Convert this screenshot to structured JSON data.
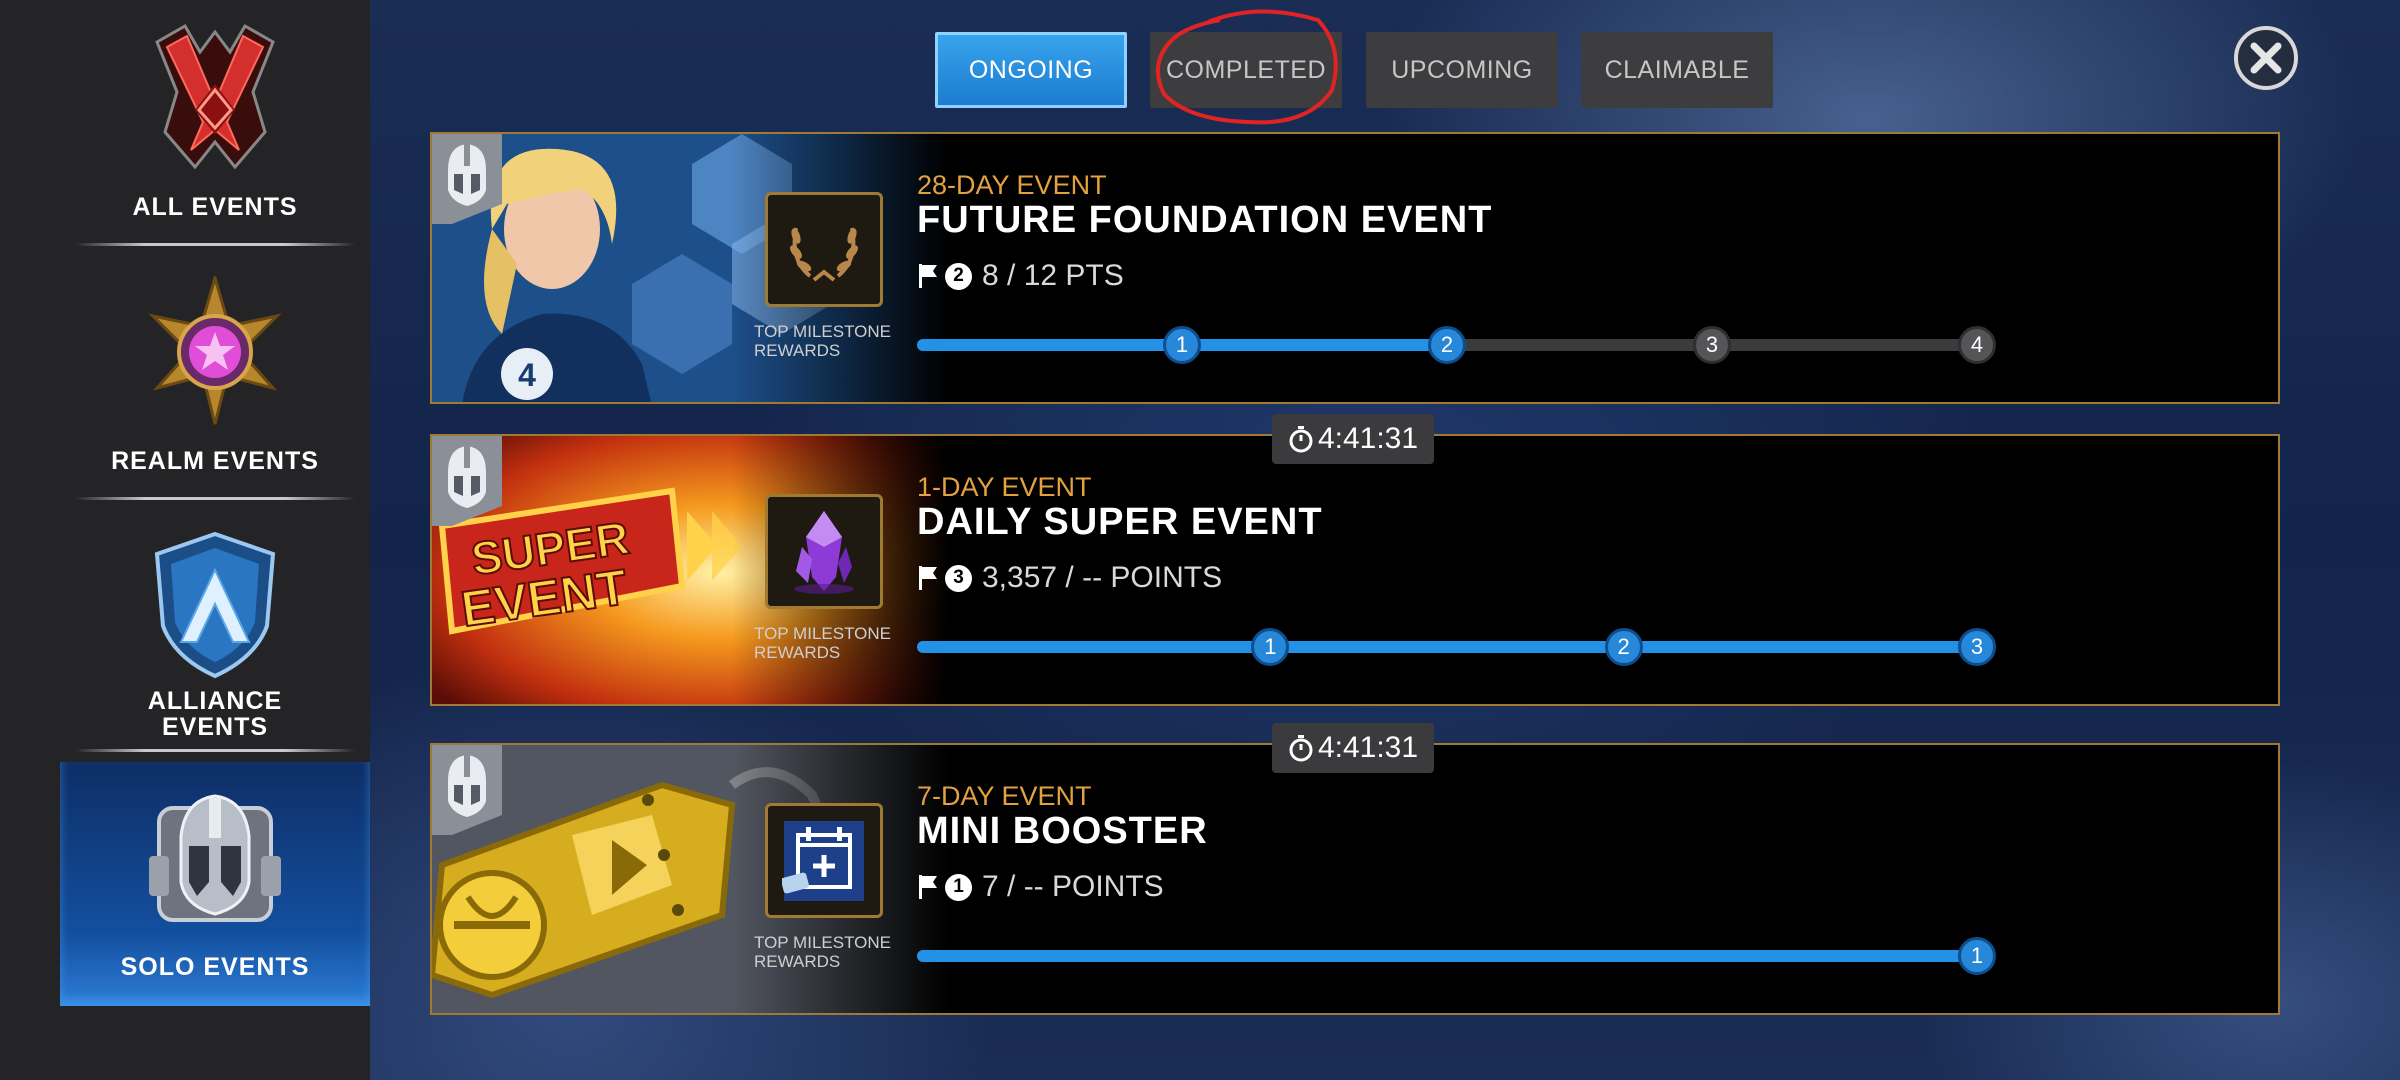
{
  "sidebar": {
    "items": [
      {
        "label": "ALL EVENTS",
        "icon": "all-events-emblem-icon"
      },
      {
        "label": "REALM EVENTS",
        "icon": "realm-events-star-icon"
      },
      {
        "label": "ALLIANCE EVENTS",
        "label_line1": "ALLIANCE",
        "label_line2": "EVENTS",
        "icon": "alliance-shield-icon"
      },
      {
        "label": "SOLO EVENTS",
        "icon": "solo-helmet-icon",
        "selected": true
      }
    ]
  },
  "tabs": [
    {
      "label": "ONGOING",
      "active": true
    },
    {
      "label": "COMPLETED",
      "active": false,
      "annotated": true
    },
    {
      "label": "UPCOMING",
      "active": false
    },
    {
      "label": "CLAIMABLE",
      "active": false
    }
  ],
  "close_icon": "close-icon",
  "reward_label_line1": "TOP MILESTONE",
  "reward_label_line2": "REWARDS",
  "events": [
    {
      "duration": "28-DAY EVENT",
      "title": "FUTURE FOUNDATION EVENT",
      "tier": "2",
      "points": "8 / 12 PTS",
      "reward_icon": "laurel-wreath-icon",
      "milestones": [
        "1",
        "2",
        "3",
        "4"
      ],
      "milestones_reached": 2,
      "progress": 0.5
    },
    {
      "timer": "4:41:31",
      "duration": "1-DAY EVENT",
      "title": "DAILY SUPER EVENT",
      "tier": "3",
      "points": "3,357 / -- POINTS",
      "reward_icon": "purple-crystal-icon",
      "milestones": [
        "1",
        "2",
        "3"
      ],
      "milestones_reached": 3,
      "progress": 1.0
    },
    {
      "timer": "4:41:31",
      "duration": "7-DAY EVENT",
      "title": "MINI BOOSTER",
      "tier": "1",
      "points": "7 / -- POINTS",
      "reward_icon": "calendar-booster-icon",
      "milestones": [
        "1"
      ],
      "milestones_reached": 1,
      "progress": 1.0
    }
  ],
  "colors": {
    "accent_blue": "#2291e6",
    "event_orange": "#e3a13f",
    "card_border_gold": "#a07a33",
    "sidebar_bg": "#242426",
    "annotation_red": "#e02424"
  }
}
